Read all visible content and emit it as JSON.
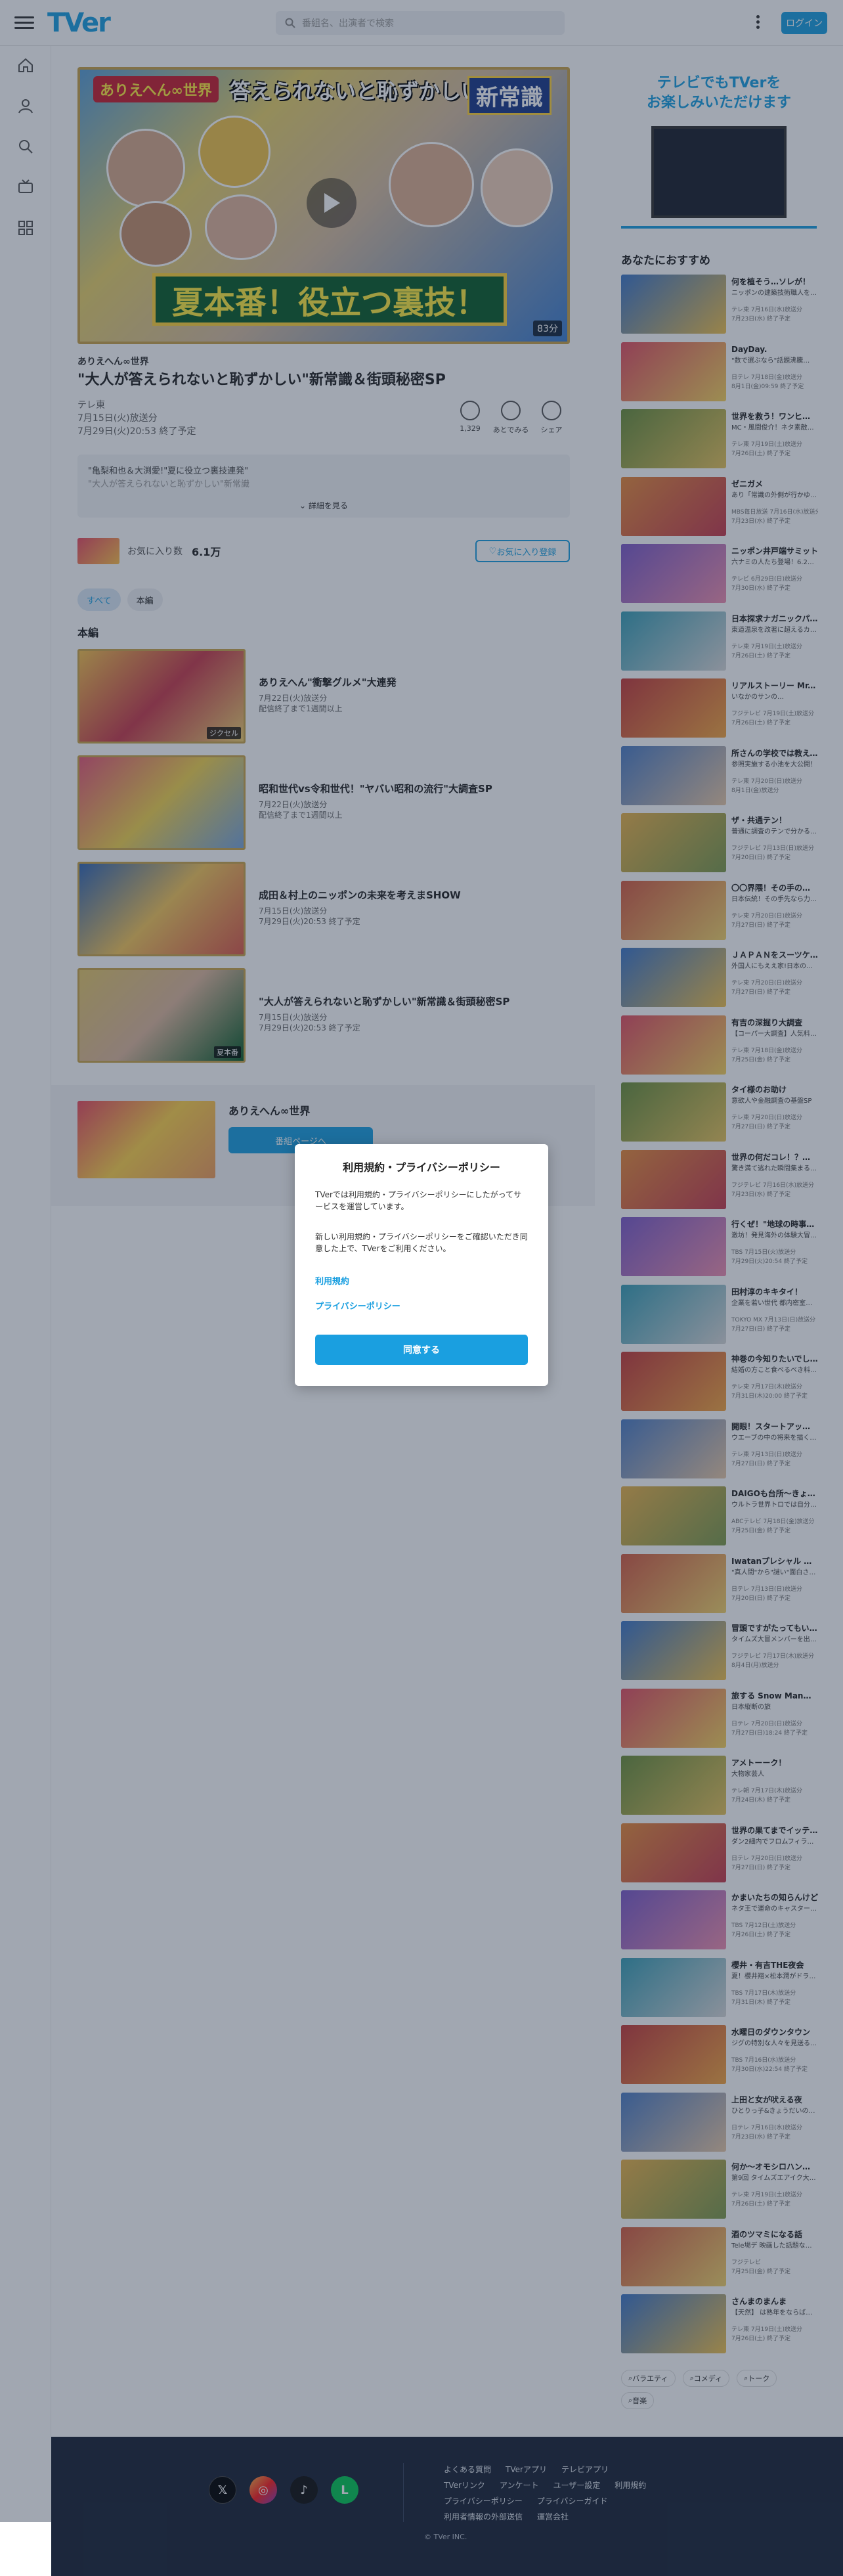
{
  "header": {
    "logo": "TVer",
    "search_placeholder": "番組名、出演者で検索",
    "login_label": "ログイン"
  },
  "episode": {
    "hero_top_left": "ありえへん∞世界",
    "hero_top_text": "答えられないと恥ずかしい!?",
    "hero_badge": "新常識",
    "hero_band": "夏本番！役立つ裏技！",
    "duration": "83分",
    "series": "ありえへん∞世界",
    "title": "\"大人が答えられないと恥ずかしい\"新常識＆街頭秘密SP",
    "broadcaster": "テレ東",
    "aired": "7月15日(火)放送分",
    "expires": "7月29日(火)20:53 終了予定",
    "actions": [
      {
        "label": "1,329"
      },
      {
        "label": "あとでみる"
      },
      {
        "label": "シェア"
      }
    ],
    "description_1": "\"亀梨和也＆大渕愛!\"夏に役立つ裏技連発\"",
    "description_2": "\"大人が答えられないと恥ずかしい\"新常識",
    "more_label": "詳細を見る",
    "fav_label": "お気に入り数",
    "fav_count": "6.1万",
    "fav_button": "お気に入り登録"
  },
  "chips": [
    {
      "label": "すべて"
    },
    {
      "label": "本編"
    }
  ],
  "section_title": "本編",
  "episodes": [
    {
      "title": "ありえへん\"衝撃グルメ\"大連発",
      "aired": "7月22日(火)放送分",
      "expires": "配信終了まで1週間以上",
      "thumb_text": "ジクセル"
    },
    {
      "title": "昭和世代vs令和世代！\"ヤバい昭和の流行\"大調査SP",
      "aired": "7月22日(火)放送分",
      "expires": "配信終了まで1週間以上",
      "thumb_text": ""
    },
    {
      "title": "成田＆村上のニッポンの未来を考えまSHOW",
      "aired": "7月15日(火)放送分",
      "expires": "7月29日(火)20:53 終了予定",
      "thumb_text": ""
    },
    {
      "title": "\"大人が答えられないと恥ずかしい\"新常識＆街頭秘密SP",
      "aired": "7月15日(火)放送分",
      "expires": "7月29日(火)20:53 終了予定",
      "thumb_text": "夏本番"
    }
  ],
  "series_band": {
    "title": "ありえへん∞世界",
    "button": "番組ページへ"
  },
  "ad": {
    "line1": "テレビでもTVerを",
    "line2": "お楽しみいただけます"
  },
  "recommend_title": "あなたにおすすめ",
  "recommendations": [
    {
      "title": "何を植そう…ソレが！",
      "sub": "ニッポンの建築技術職人を世界…",
      "m1": "テレ東 7月16日(水)放送分",
      "m2": "7月23日(水) 終了予定"
    },
    {
      "title": "DayDay.",
      "sub": "\"数で選ぶなら\"話題沸騰…",
      "m1": "日テレ 7月18日(金)放送分",
      "m2": "8月1日(金)09:59 終了予定"
    },
    {
      "title": "世界を救う！ワンヒャフル…",
      "sub": "MC・風間俊介！ネタ素敵すぎ…",
      "m1": "テレ東 7月19日(土)放送分",
      "m2": "7月26日(土) 終了予定"
    },
    {
      "title": "ゼニガメ",
      "sub": "あり「常識の外側が行かゆうケ…",
      "m1": "MBS毎日放送 7月16日(水)放送分",
      "m2": "7月23日(水) 終了予定"
    },
    {
      "title": "ニッポン井戸端サミット",
      "sub": "六ナミの人たち登場！6.20…",
      "m1": "テレビ 6月29日(日)放送分",
      "m2": "7月30日(水) 終了予定"
    },
    {
      "title": "日本探求ナガニックパラ…",
      "sub": "東道温泉を改著に超えるカル…",
      "m1": "テレ東 7月19日(土)放送分",
      "m2": "7月26日(土) 終了予定"
    },
    {
      "title": "リアルストーリー Mr.サン…",
      "sub": "いなかのサンの…",
      "m1": "フジテレビ 7月19日(土)放送分",
      "m2": "7月26日(土) 終了予定"
    },
    {
      "title": "所さんの学校では教えてく…",
      "sub": "参照実施する小池を大公開！",
      "m1": "テレ東 7月20日(日)放送分",
      "m2": "8月1日(金)放送分"
    },
    {
      "title": "ザ・共通テン！",
      "sub": "普通に調査のテンで分かるがし…",
      "m1": "フジテレビ 7月13日(日)放送分",
      "m2": "7月20日(日) 終了予定"
    },
    {
      "title": "〇〇界隈！その手の気が絶…",
      "sub": "日本伝統！その手先なら力…",
      "m1": "テレ東 7月20日(日)放送分",
      "m2": "7月27日(日) 終了予定"
    },
    {
      "title": "ＪＡＰＡＮをスーツケース…",
      "sub": "外国人にもええ家!日本のビジ…",
      "m1": "テレ東 7月20日(日)放送分",
      "m2": "7月27日(日) 終了予定"
    },
    {
      "title": "有吉の深掘り大調査",
      "sub": "【コーパー大調査】人気料理…",
      "m1": "テレ東 7月18日(金)放送分",
      "m2": "7月25日(金) 終了予定"
    },
    {
      "title": "タイ様のお助け",
      "sub": "意欲人や金融調査の基盤SP",
      "m1": "テレ東 7月20日(日)放送分",
      "m2": "7月27日(日) 終了予定"
    },
    {
      "title": "世界の何だコレ！？ミス…",
      "sub": "驚き満て逃れた瞬間集まる…",
      "m1": "フジテレビ 7月16日(水)放送分",
      "m2": "7月23日(水) 終了予定"
    },
    {
      "title": "行くぜ！\"地球の時事探\"ロ…",
      "sub": "激坊！発見海外の体験大冒険…",
      "m1": "TBS 7月15日(火)放送分",
      "m2": "7月29日(火)20:54 終了予定"
    },
    {
      "title": "田村淳のキキタイ！",
      "sub": "企業を若い世代 都内密室開示…",
      "m1": "TOKYO MX 7月13日(日)放送分",
      "m2": "7月27日(日) 終了予定"
    },
    {
      "title": "神巻の今知りたいでしょ！",
      "sub": "結婚の方こと食べるべき料理…",
      "m1": "テレ東 7月17日(木)放送分",
      "m2": "7月31日(木)20:00 終了予定"
    },
    {
      "title": "開眼！スタートアップ ヒロ…",
      "sub": "ウエーブの中の将来を描く…",
      "m1": "テレ東 7月13日(日)放送分",
      "m2": "7月27日(日) 終了予定"
    },
    {
      "title": "DAIGOも台所〜きょうの…",
      "sub": "ウルトラ世界トロでは自分好き…",
      "m1": "ABCテレビ 7月18日(金)放送分",
      "m2": "7月25日(金) 終了予定"
    },
    {
      "title": "Iwatanプレシャル 風人…",
      "sub": "\"真人間\"から\"謎い\"面白さを…",
      "m1": "日テレ 7月13日(日)放送分",
      "m2": "7月20日(日) 終了予定"
    },
    {
      "title": "冒頭ですがたってもいいで…",
      "sub": "タイムズ大冒メンバーを出い…",
      "m1": "フジテレビ 7月17日(木)放送分",
      "m2": "8月4日(月)放送分"
    },
    {
      "title": "旅する Snow Man・Tra…",
      "sub": "日本縦断の旅",
      "m1": "日テレ 7月20日(日)放送分",
      "m2": "7月27日(日)18:24 終了予定"
    },
    {
      "title": "アメトーーク！",
      "sub": "大物家芸人",
      "m1": "テレ朝 7月17日(木)放送分",
      "m2": "7月24日(木) 終了予定"
    },
    {
      "title": "世界の果てまでイッテQ！",
      "sub": "ダン2細内でフロムフィラス芸…",
      "m1": "日テレ 7月20日(日)放送分",
      "m2": "7月27日(日) 終了予定"
    },
    {
      "title": "かまいたちの知らんけど",
      "sub": "ネタ王で運命のキャスターを…",
      "m1": "TBS 7月12日(土)放送分",
      "m2": "7月26日(土) 終了予定"
    },
    {
      "title": "櫻井・有吉THE夜会",
      "sub": "夏！櫻井翔×松本潤がドラマ…",
      "m1": "TBS 7月17日(木)放送分",
      "m2": "7月31日(木) 終了予定"
    },
    {
      "title": "水曜日のダウンタウン",
      "sub": "ジグの特別な人々を見送る…",
      "m1": "TBS 7月16日(水)放送分",
      "m2": "7月30日(水)22:54 終了予定"
    },
    {
      "title": "上田と女が吠える夜",
      "sub": "ひとりっ子&きょうだいの多い女…",
      "m1": "日テレ 7月16日(水)放送分",
      "m2": "7月23日(水) 終了予定"
    },
    {
      "title": "何か〜オモシロハン〜\"ないし…",
      "sub": "第9回 タイムズエアイク大会…",
      "m1": "テレ東 7月19日(土)放送分",
      "m2": "7月26日(土) 終了予定"
    },
    {
      "title": "酒のツマミになる話",
      "sub": "Tele場デ 映画した話題なし…",
      "m1": "フジテレビ",
      "m2": "7月25日(金) 終了予定"
    },
    {
      "title": "さんまのまんま",
      "sub": "【天然】 は熟年をならばさんま…",
      "m1": "テレ東 7月19日(土)放送分",
      "m2": "7月26日(土) 終了予定"
    }
  ],
  "tags": [
    {
      "label": "バラエティ"
    },
    {
      "label": "コメディ"
    },
    {
      "label": "トーク"
    },
    {
      "label": "音楽"
    }
  ],
  "footer": {
    "links": [
      "よくある質問",
      "TVerアプリ",
      "テレビアプリ",
      "TVerリンク",
      "アンケート",
      "ユーザー設定",
      "利用規約",
      "プライバシーポリシー",
      "プライバシーガイド",
      "利用者情報の外部送信",
      "運営会社"
    ],
    "copyright": "© TVer INC."
  },
  "modal": {
    "title": "利用規約・プライバシーポリシー",
    "para1": "TVerでは利用規約・プライバシーポリシーにしたがってサービスを運営しています。",
    "para2": "新しい利用規約・プライバシーポリシーをご確認いただき同意した上で、TVerをご利用ください。",
    "link_terms": "利用規約",
    "link_privacy": "プライバシーポリシー",
    "agree_button": "同意する"
  },
  "colors": {
    "accent": "#1a9fe0",
    "footer_bg": "#1b2436",
    "overlay": "rgba(30,45,70,0.42)"
  }
}
